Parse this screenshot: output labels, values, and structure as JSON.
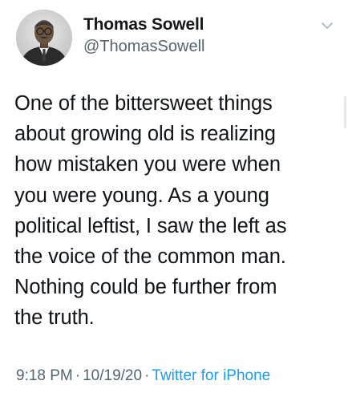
{
  "tweet": {
    "author_name": "Thomas Sowell",
    "author_handle": "@ThomasSowell",
    "avatar_icon": "user-avatar",
    "menu_icon": "chevron-down-icon",
    "text_lines": [
      "One of the bittersweet things",
      "about growing old is realizing",
      "how mistaken you were when",
      "you were young. As a young",
      "political leftist, I saw the left as",
      "the voice of the common man.",
      "Nothing could be further from",
      "the truth."
    ],
    "time": "9:18 PM",
    "date": "10/19/20",
    "source": "Twitter for iPhone",
    "separator": "·"
  },
  "colors": {
    "text_primary": "#0f1419",
    "text_secondary": "#536471",
    "link": "#1d9bf0"
  }
}
